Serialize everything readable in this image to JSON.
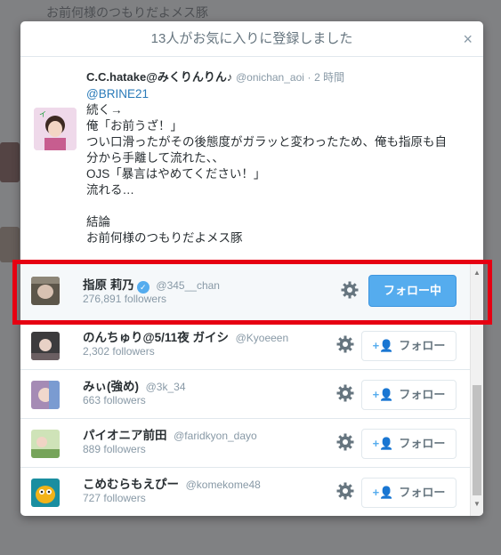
{
  "background": {
    "tweet_text": "お前何様のつもりだよメス豚"
  },
  "modal": {
    "title": "13人がお気に入りに登録しました",
    "close_glyph": "×"
  },
  "tweet": {
    "name": "C.C.hatake@みくりんりん♪",
    "handle": "@onichan_aoi",
    "separator": "·",
    "time": "2 時間",
    "mention": "@BRINE21",
    "lines": [
      "続く→",
      "俺「お前うざ！」",
      "つい口滑ったがその後態度がガラッと変わったため、俺も指原も自",
      "分から手離して流れた、、",
      "OJS「暴言はやめてください！」",
      "流れる…",
      "",
      "結論",
      "お前何様のつもりだよメス豚"
    ]
  },
  "users": [
    {
      "name": "指原 莉乃",
      "verified": true,
      "handle": "@345__chan",
      "followers": "276,891 followers",
      "button": "フォロー中",
      "following": true,
      "avatar_color": "#5c564a"
    },
    {
      "name": "のんちゅり@5/11夜 ガイシ",
      "verified": false,
      "handle": "@Kyoeeen",
      "followers": "2,302 followers",
      "button": "フォロー",
      "following": false,
      "avatar_color": "#3c3b3d"
    },
    {
      "name": "みぃ(強め)",
      "verified": false,
      "handle": "@3k_34",
      "followers": "663 followers",
      "button": "フォロー",
      "following": false,
      "avatar_color": "#a58bb5"
    },
    {
      "name": "パイオニア前田",
      "verified": false,
      "handle": "@faridkyon_dayo",
      "followers": "889 followers",
      "button": "フォロー",
      "following": false,
      "avatar_color": "#76a45a"
    },
    {
      "name": "こめむらもえぴー",
      "verified": false,
      "handle": "@komekome48",
      "followers": "727 followers",
      "button": "フォロー",
      "following": false,
      "avatar_color": "#1a8ea0"
    }
  ],
  "colors": {
    "accent": "#55acee",
    "highlight": "#e60012"
  },
  "icons": {
    "close": "close-icon",
    "settings": "gear-icon",
    "follow": "add-user-icon",
    "verified": "verified-badge-icon"
  }
}
